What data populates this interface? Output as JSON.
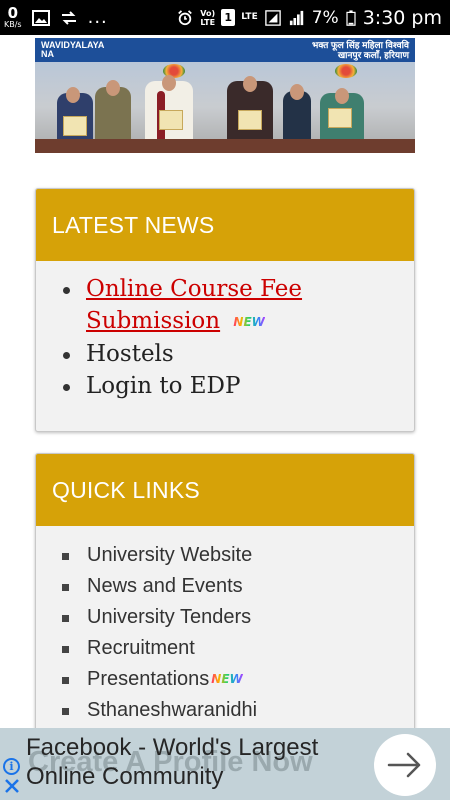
{
  "status_bar": {
    "net_speed_value": "0",
    "net_speed_unit": "KB/s",
    "overflow_dots": "...",
    "volte_line1": "Vo)",
    "volte_line2": "LTE",
    "sim_slot": "1",
    "lte_label": "LTE",
    "battery_percent": "7%",
    "time": "3:30 pm"
  },
  "banner": {
    "left_text_line1": "WAVIDYALAYA",
    "left_text_line2": "NA",
    "right_text_line1": "भक्त फूल सिंह महिला विश्ववि",
    "right_text_line2": "खानपुर कलाँ, हरियाण"
  },
  "latest_news": {
    "title": "LATEST NEWS",
    "items": [
      {
        "label": "Online Course Fee Submission",
        "is_link": true,
        "badge": "NEW"
      },
      {
        "label": "Hostels",
        "is_link": false,
        "badge": ""
      },
      {
        "label": "Login to EDP",
        "is_link": false,
        "badge": ""
      }
    ]
  },
  "quick_links": {
    "title": "QUICK LINKS",
    "items": [
      {
        "label": "University Website",
        "badge": ""
      },
      {
        "label": "News and Events",
        "badge": ""
      },
      {
        "label": "University Tenders",
        "badge": ""
      },
      {
        "label": "Recruitment",
        "badge": ""
      },
      {
        "label": "Presentations",
        "badge": "NEW"
      },
      {
        "label": "Sthaneshwaranidhi",
        "badge": ""
      }
    ]
  },
  "ad": {
    "title": "Facebook - World's Largest Online Community",
    "background_text": "Create A Profile Now",
    "info_icon": "info-icon",
    "close_icon": "close-icon",
    "cta_icon": "arrow-right-icon"
  },
  "colors": {
    "header_gold": "#d6a208",
    "link_red": "#cc0000",
    "card_bg": "#f2f2f2",
    "ad_bg": "#c3d2d8"
  }
}
